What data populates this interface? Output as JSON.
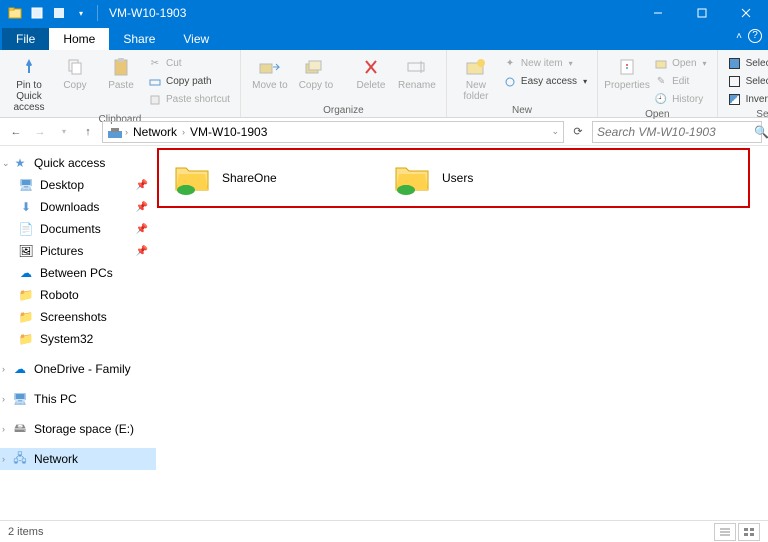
{
  "window": {
    "title": "VM-W10-1903"
  },
  "tabs": {
    "file": "File",
    "home": "Home",
    "share": "Share",
    "view": "View"
  },
  "ribbon": {
    "clipboard": {
      "label": "Clipboard",
      "pin": "Pin to Quick access",
      "copy": "Copy",
      "paste": "Paste",
      "cut": "Cut",
      "copy_path": "Copy path",
      "paste_shortcut": "Paste shortcut"
    },
    "organize": {
      "label": "Organize",
      "move_to": "Move to",
      "copy_to": "Copy to",
      "delete": "Delete",
      "rename": "Rename"
    },
    "new": {
      "label": "New",
      "new_folder": "New folder",
      "new_item": "New item",
      "easy_access": "Easy access"
    },
    "open": {
      "label": "Open",
      "properties": "Properties",
      "open": "Open",
      "edit": "Edit",
      "history": "History"
    },
    "select": {
      "label": "Select",
      "select_all": "Select all",
      "select_none": "Select none",
      "invert": "Invert selection"
    }
  },
  "address": {
    "crumbs": [
      "Network",
      "VM-W10-1903"
    ],
    "search_placeholder": "Search VM-W10-1903"
  },
  "nav": {
    "quick_access": "Quick access",
    "desktop": "Desktop",
    "downloads": "Downloads",
    "documents": "Documents",
    "pictures": "Pictures",
    "between_pcs": "Between PCs",
    "roboto": "Roboto",
    "screenshots": "Screenshots",
    "system32": "System32",
    "onedrive": "OneDrive - Family",
    "this_pc": "This PC",
    "storage": "Storage space (E:)",
    "network": "Network"
  },
  "content": {
    "items": [
      {
        "name": "ShareOne"
      },
      {
        "name": "Users"
      }
    ]
  },
  "status": {
    "count": "2 items"
  }
}
